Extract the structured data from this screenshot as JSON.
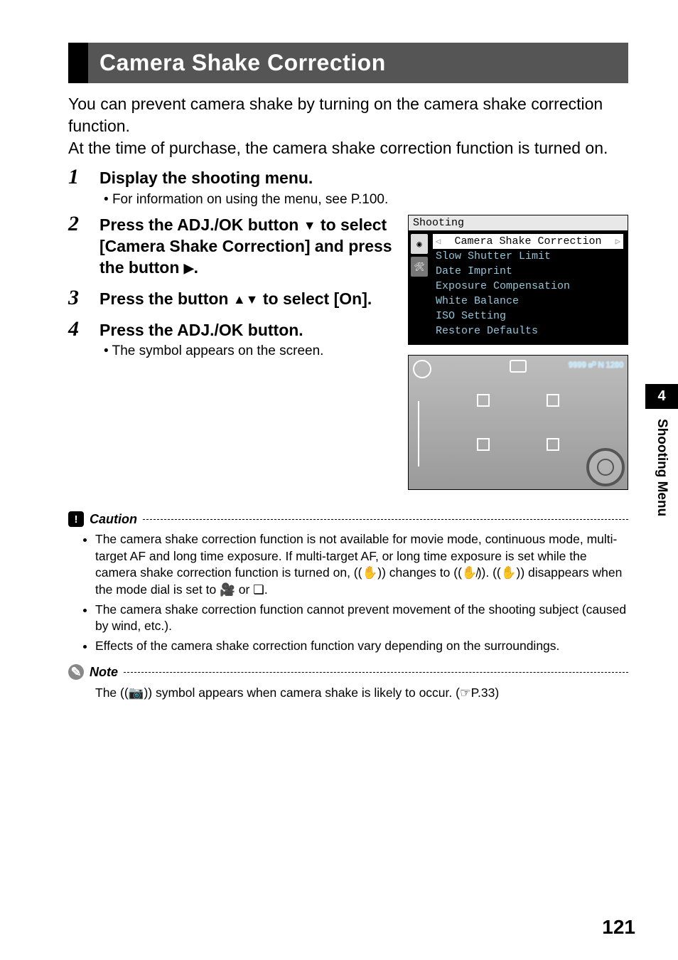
{
  "title": "Camera Shake Correction",
  "intro": "You can prevent camera shake by turning on the camera shake correction function.\nAt the time of purchase, the camera shake correction function is turned on.",
  "steps": [
    {
      "head": "Display the shooting menu.",
      "sub": "For information on using the menu, see P.100."
    },
    {
      "head_pre": "Press the ADJ./OK button ",
      "head_arrow": "▼",
      "head_post": " to select [Camera Shake Correction] and press the button ",
      "head_arrow2": "▶",
      "head_end": "."
    },
    {
      "head_pre": "Press the button ",
      "head_arrow": "▲▼",
      "head_post": " to select [On]."
    },
    {
      "head": "Press the ADJ./OK button.",
      "sub": "The symbol appears on the screen."
    }
  ],
  "menu": {
    "title": "Shooting",
    "selected": "Camera Shake Correction",
    "items": [
      "Slow Shutter Limit",
      "Date Imprint",
      "Exposure Compensation",
      "White Balance",
      "ISO Setting",
      "Restore Defaults"
    ]
  },
  "live": {
    "topright": "9999 ᵴᴰ N 1280"
  },
  "side": {
    "num": "4",
    "label": "Shooting Menu"
  },
  "caution": {
    "label": "Caution",
    "items": [
      "The camera shake correction function is not available for movie mode, continuous mode, multi-target AF and long time exposure. If multi-target AF, or long time exposure is set while the camera shake correction function is turned on, ((✋)) changes to ((✋̸)). ((✋)) disappears when the mode dial is set to 🎥 or ❏.",
      "The camera shake correction function cannot prevent movement of the shooting subject (caused by wind, etc.).",
      "Effects of the camera shake correction function vary depending on the surroundings."
    ]
  },
  "note": {
    "label": "Note",
    "text": "The ((📷)) symbol appears when camera shake is likely to occur. (☞P.33)"
  },
  "pageNumber": "121"
}
